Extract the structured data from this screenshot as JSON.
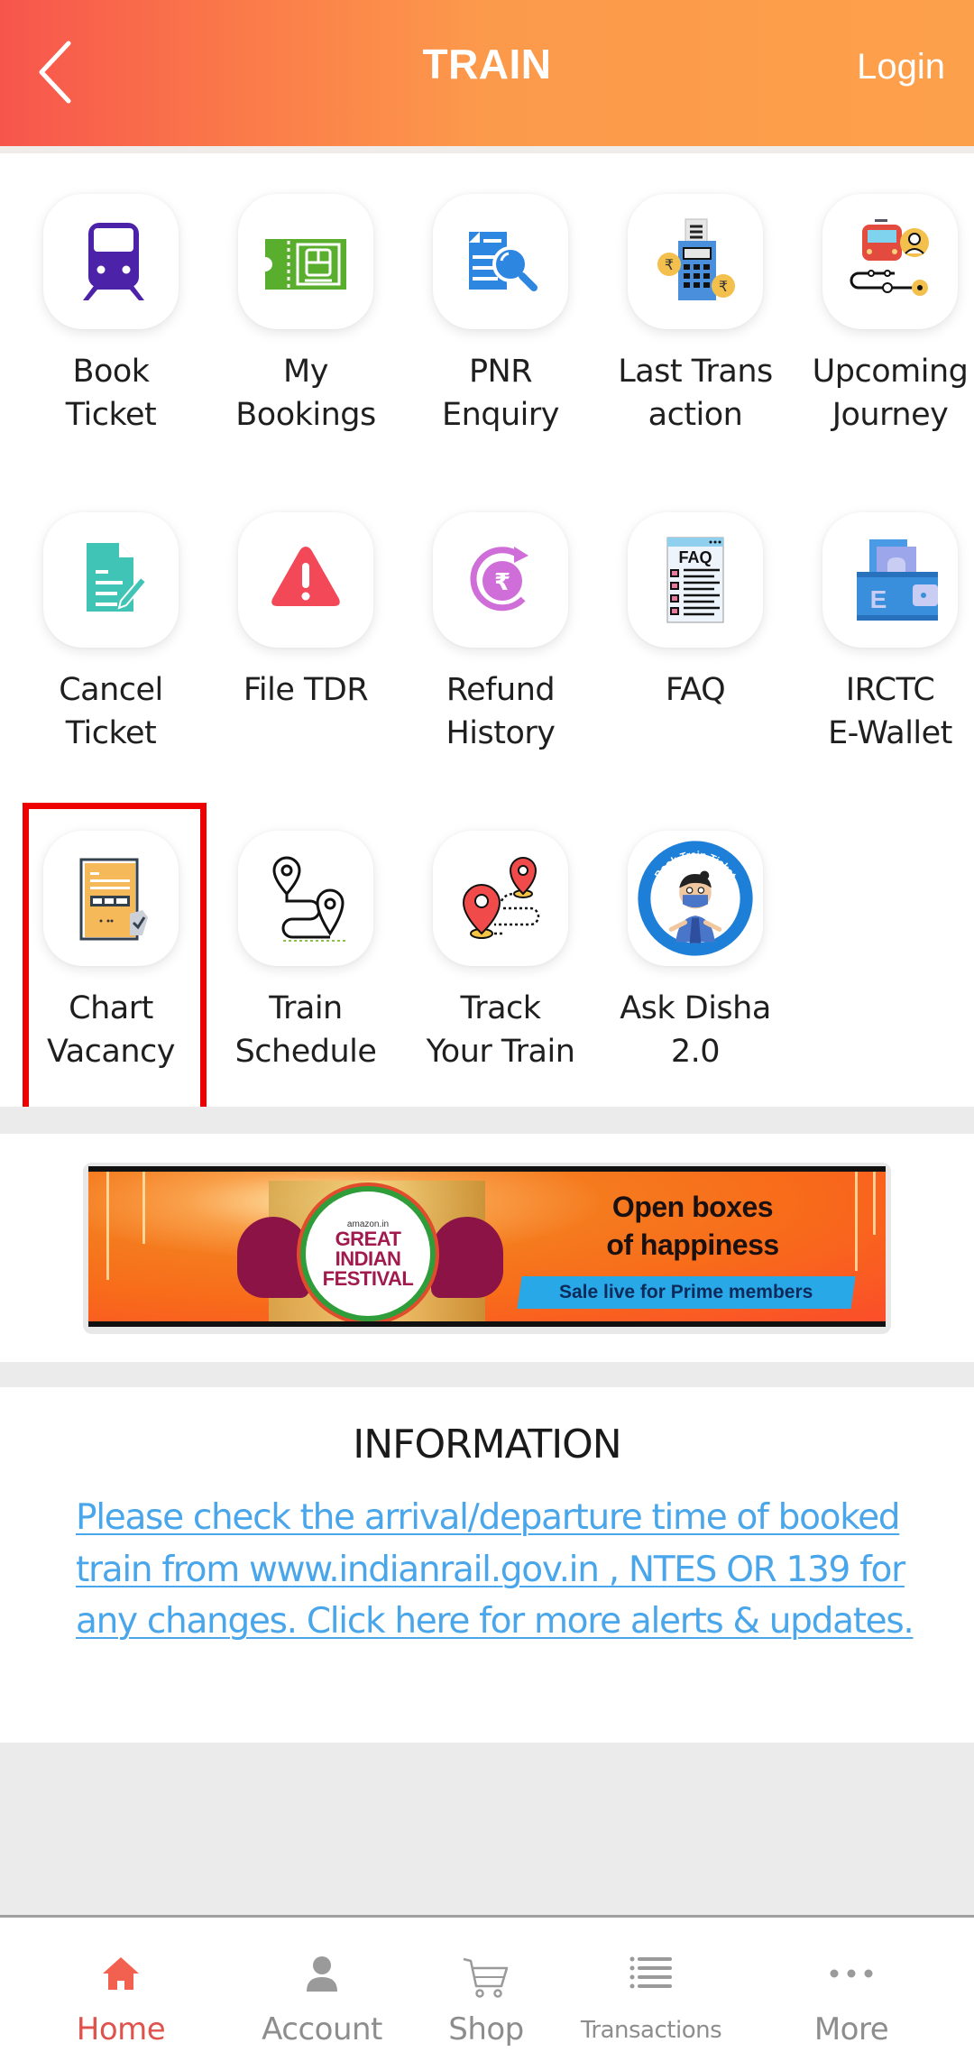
{
  "header": {
    "title": "TRAIN",
    "back_icon": "chevron-left-icon",
    "login_label": "Login"
  },
  "services": [
    {
      "id": "book-ticket",
      "label_line1": "Book",
      "label_line2": "Ticket",
      "icon": "train-front-icon",
      "icon_color": "#4b22a8"
    },
    {
      "id": "my-bookings",
      "label_line1": "My",
      "label_line2": "Bookings",
      "icon": "ticket-icon",
      "icon_color": "#5aae2e"
    },
    {
      "id": "pnr-enquiry",
      "label_line1": "PNR",
      "label_line2": "Enquiry",
      "icon": "document-search-icon",
      "icon_color": "#2d86e0"
    },
    {
      "id": "last-transaction",
      "label_line1": "Last Trans",
      "label_line2": "action",
      "icon": "payment-terminal-icon",
      "icon_color": "#4a8fdc"
    },
    {
      "id": "upcoming-journey",
      "label_line1": "Upcoming",
      "label_line2": "Journey",
      "icon": "train-journey-icon",
      "icon_color": "#e34b3f"
    },
    {
      "id": "cancel-ticket",
      "label_line1": "Cancel",
      "label_line2": "Ticket",
      "icon": "document-edit-icon",
      "icon_color": "#3fc4b5"
    },
    {
      "id": "file-tdr",
      "label_line1": "File TDR",
      "label_line2": "",
      "icon": "warning-icon",
      "icon_color": "#f24857"
    },
    {
      "id": "refund-history",
      "label_line1": "Refund",
      "label_line2": "History",
      "icon": "rupee-refresh-icon",
      "icon_color": "#cf6ed8"
    },
    {
      "id": "faq",
      "label_line1": "FAQ",
      "label_line2": "",
      "icon": "faq-document-icon",
      "icon_color": "#111111"
    },
    {
      "id": "irctc-ewallet",
      "label_line1": "IRCTC",
      "label_line2": "E-Wallet",
      "icon": "wallet-icon",
      "icon_color": "#3a8fdd"
    },
    {
      "id": "chart-vacancy",
      "label_line1": "Chart",
      "label_line2": "Vacancy",
      "icon": "chart-document-icon",
      "icon_color": "#f6b95a",
      "highlighted": true
    },
    {
      "id": "train-schedule",
      "label_line1": "Train",
      "label_line2": "Schedule",
      "icon": "route-pins-icon",
      "icon_color": "#111111"
    },
    {
      "id": "track-your-train",
      "label_line1": "Track",
      "label_line2": "Your Train",
      "icon": "location-pins-icon",
      "icon_color": "#f04a4a"
    },
    {
      "id": "ask-disha",
      "label_line1": "Ask Disha",
      "label_line2": "2.0",
      "icon": "disha-avatar-icon",
      "icon_color": "#1e7fd8",
      "badge_text": "Book Train Ticket"
    }
  ],
  "banner": {
    "badge_small": "amazon.in",
    "badge_line1": "GREAT",
    "badge_line2": "INDIAN",
    "badge_line3": "FESTIVAL",
    "headline_line1": "Open boxes",
    "headline_line2": "of happiness",
    "ribbon": "Sale live for Prime members"
  },
  "information": {
    "title": "INFORMATION",
    "link_text": "Please check the arrival/departure time of booked train from www.indianrail.gov.in , NTES OR 139 for any changes. Click here for more alerts & updates."
  },
  "bottom_nav": {
    "active": "Home",
    "items": [
      {
        "label": "Home",
        "icon": "home-icon"
      },
      {
        "label": "Account",
        "icon": "user-icon"
      },
      {
        "label": "Shop",
        "icon": "cart-icon"
      },
      {
        "label": "Transactions",
        "icon": "list-icon"
      },
      {
        "label": "More",
        "icon": "more-dots-icon"
      }
    ]
  },
  "colors": {
    "header_gradient_start": "#f7554c",
    "header_gradient_end": "#fda04b",
    "highlight_border": "#ee0000",
    "link": "#4aa6ea",
    "nav_active": "#e0524c",
    "nav_inactive": "#8d8d8d"
  }
}
